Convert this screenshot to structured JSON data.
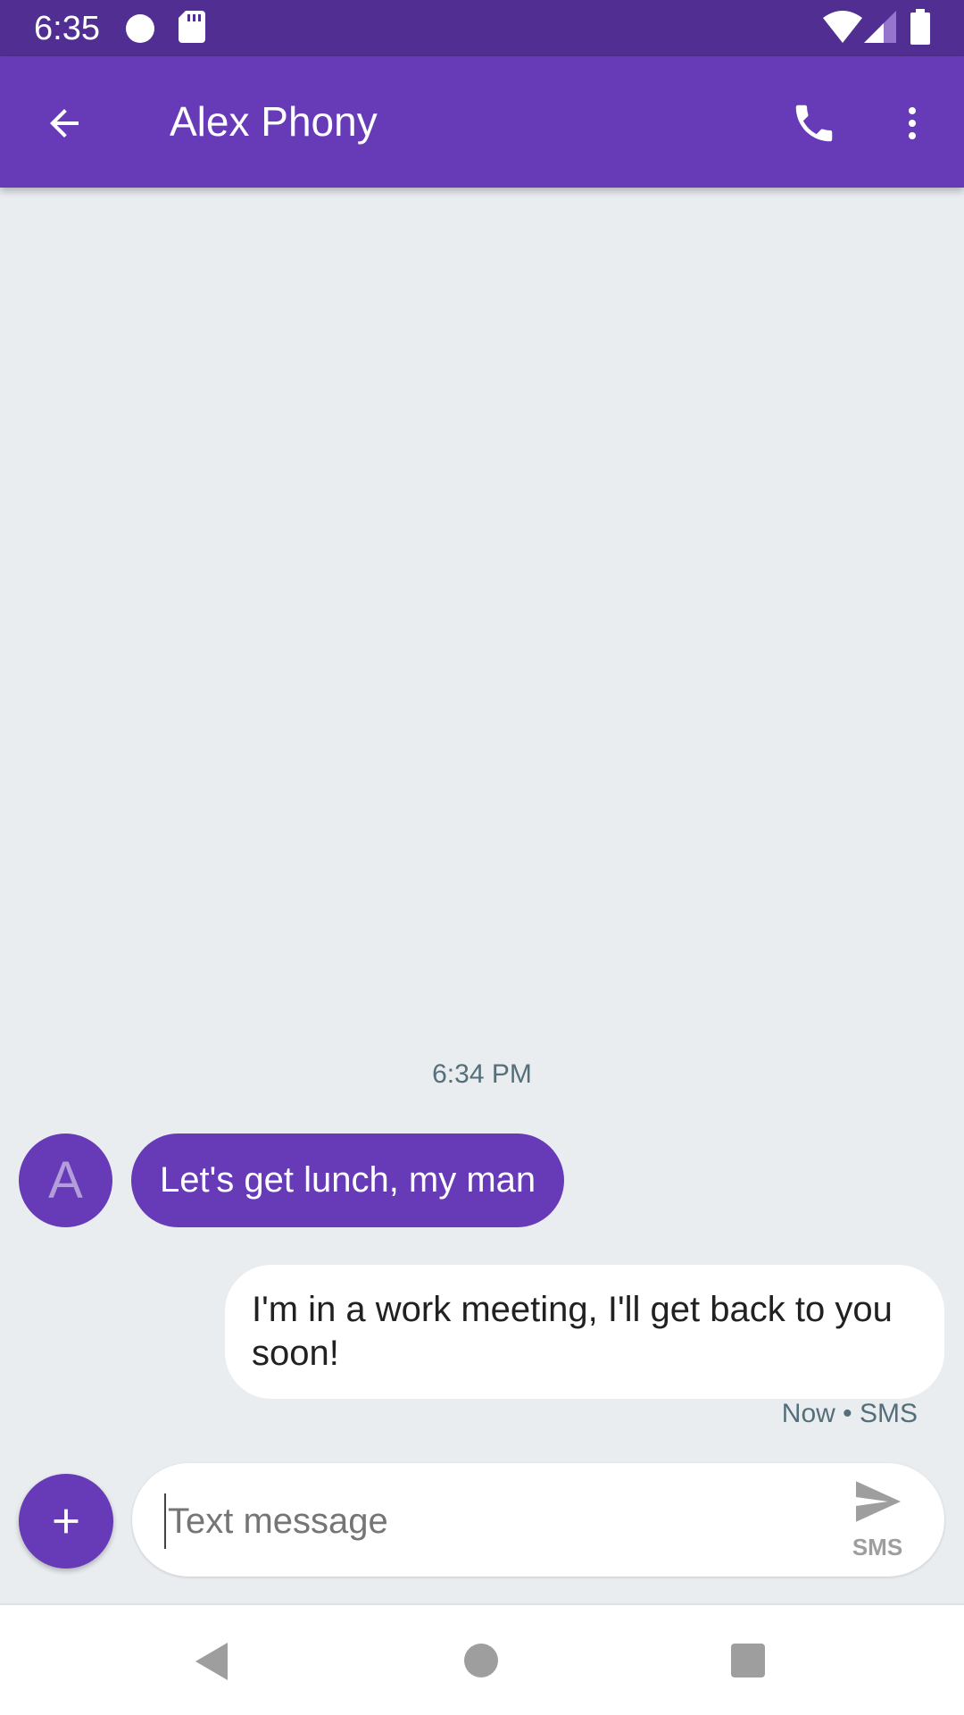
{
  "status_bar": {
    "time": "6:35",
    "icons": [
      "circle-notification-icon",
      "sd-card-icon",
      "wifi-icon",
      "cell-signal-icon",
      "battery-icon"
    ]
  },
  "app_bar": {
    "title": "Alex Phony",
    "icons": [
      "back-arrow-icon",
      "phone-icon",
      "more-vert-icon"
    ],
    "color": "#673ab7"
  },
  "conversation": {
    "timestamp": "6:34 PM",
    "messages": [
      {
        "direction": "incoming",
        "avatar_initial": "A",
        "text": "Let's get lunch, my man"
      },
      {
        "direction": "outgoing",
        "text": "I'm in a work meeting, I'll get back to you soon!",
        "meta": "Now • SMS"
      }
    ]
  },
  "compose": {
    "placeholder": "Text message",
    "value": "",
    "send_label": "SMS",
    "icons": [
      "add-icon",
      "send-icon"
    ]
  },
  "nav_bar": {
    "icons": [
      "nav-back-icon",
      "nav-home-icon",
      "nav-recents-icon"
    ]
  }
}
